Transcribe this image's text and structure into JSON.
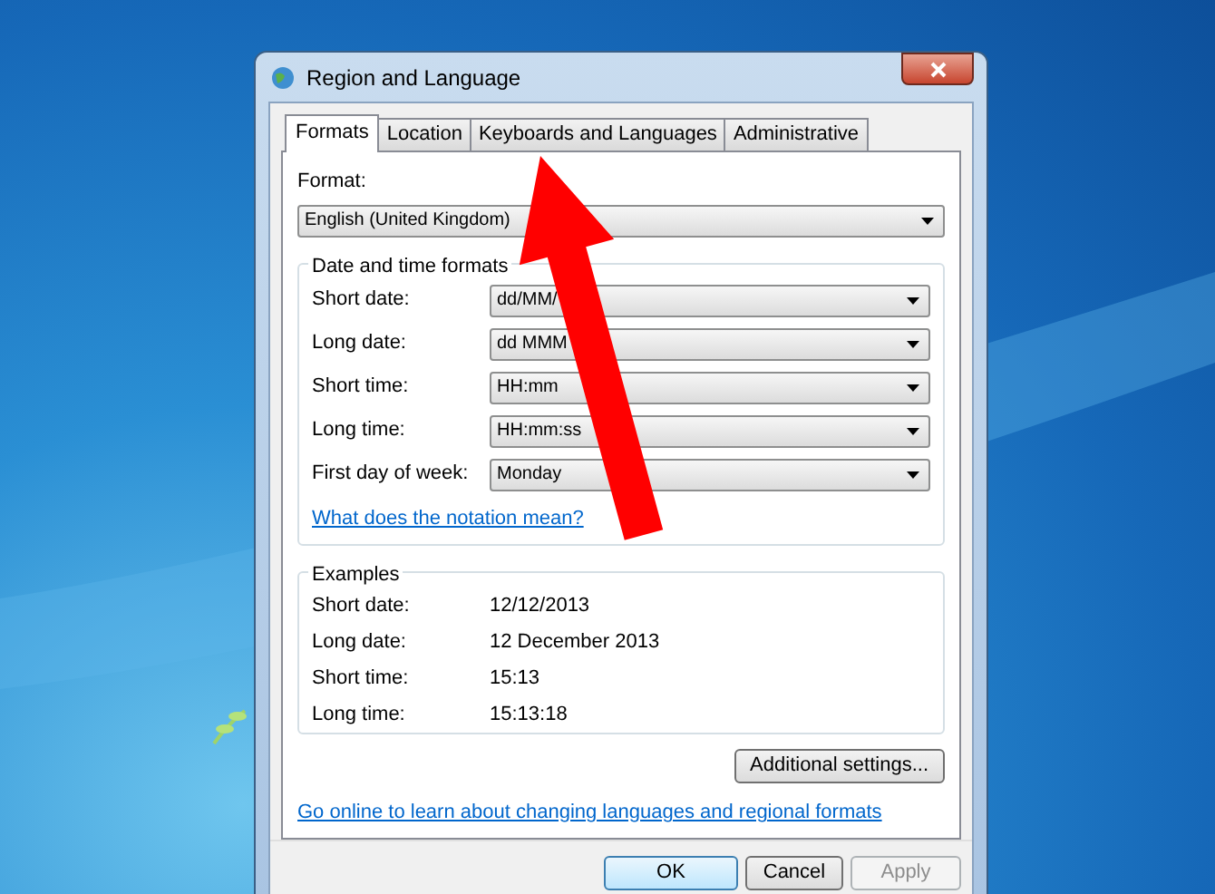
{
  "window": {
    "title": "Region and Language"
  },
  "tabs": [
    {
      "label": "Formats",
      "selected": true
    },
    {
      "label": "Location",
      "selected": false
    },
    {
      "label": "Keyboards and Languages",
      "selected": false
    },
    {
      "label": "Administrative",
      "selected": false
    }
  ],
  "format": {
    "label": "Format:",
    "value": "English (United Kingdom)"
  },
  "date_time_formats": {
    "title": "Date and time formats",
    "rows": [
      {
        "label": "Short date:",
        "value": "dd/MM/"
      },
      {
        "label": "Long date:",
        "value": "dd MMM"
      },
      {
        "label": "Short time:",
        "value": "HH:mm"
      },
      {
        "label": "Long time:",
        "value": "HH:mm:ss"
      },
      {
        "label": "First day of week:",
        "value": "Monday"
      }
    ],
    "link": "What does the notation mean?"
  },
  "examples": {
    "title": "Examples",
    "rows": [
      {
        "label": "Short date:",
        "value": "12/12/2013"
      },
      {
        "label": "Long date:",
        "value": "12 December 2013"
      },
      {
        "label": "Short time:",
        "value": "15:13"
      },
      {
        "label": "Long time:",
        "value": "15:13:18"
      }
    ]
  },
  "additional_settings_button": "Additional settings...",
  "online_link": "Go online to learn about changing languages and regional formats",
  "buttons": [
    {
      "label": "OK",
      "default": true,
      "disabled": false
    },
    {
      "label": "Cancel",
      "default": false,
      "disabled": false
    },
    {
      "label": "Apply",
      "default": false,
      "disabled": true
    }
  ]
}
